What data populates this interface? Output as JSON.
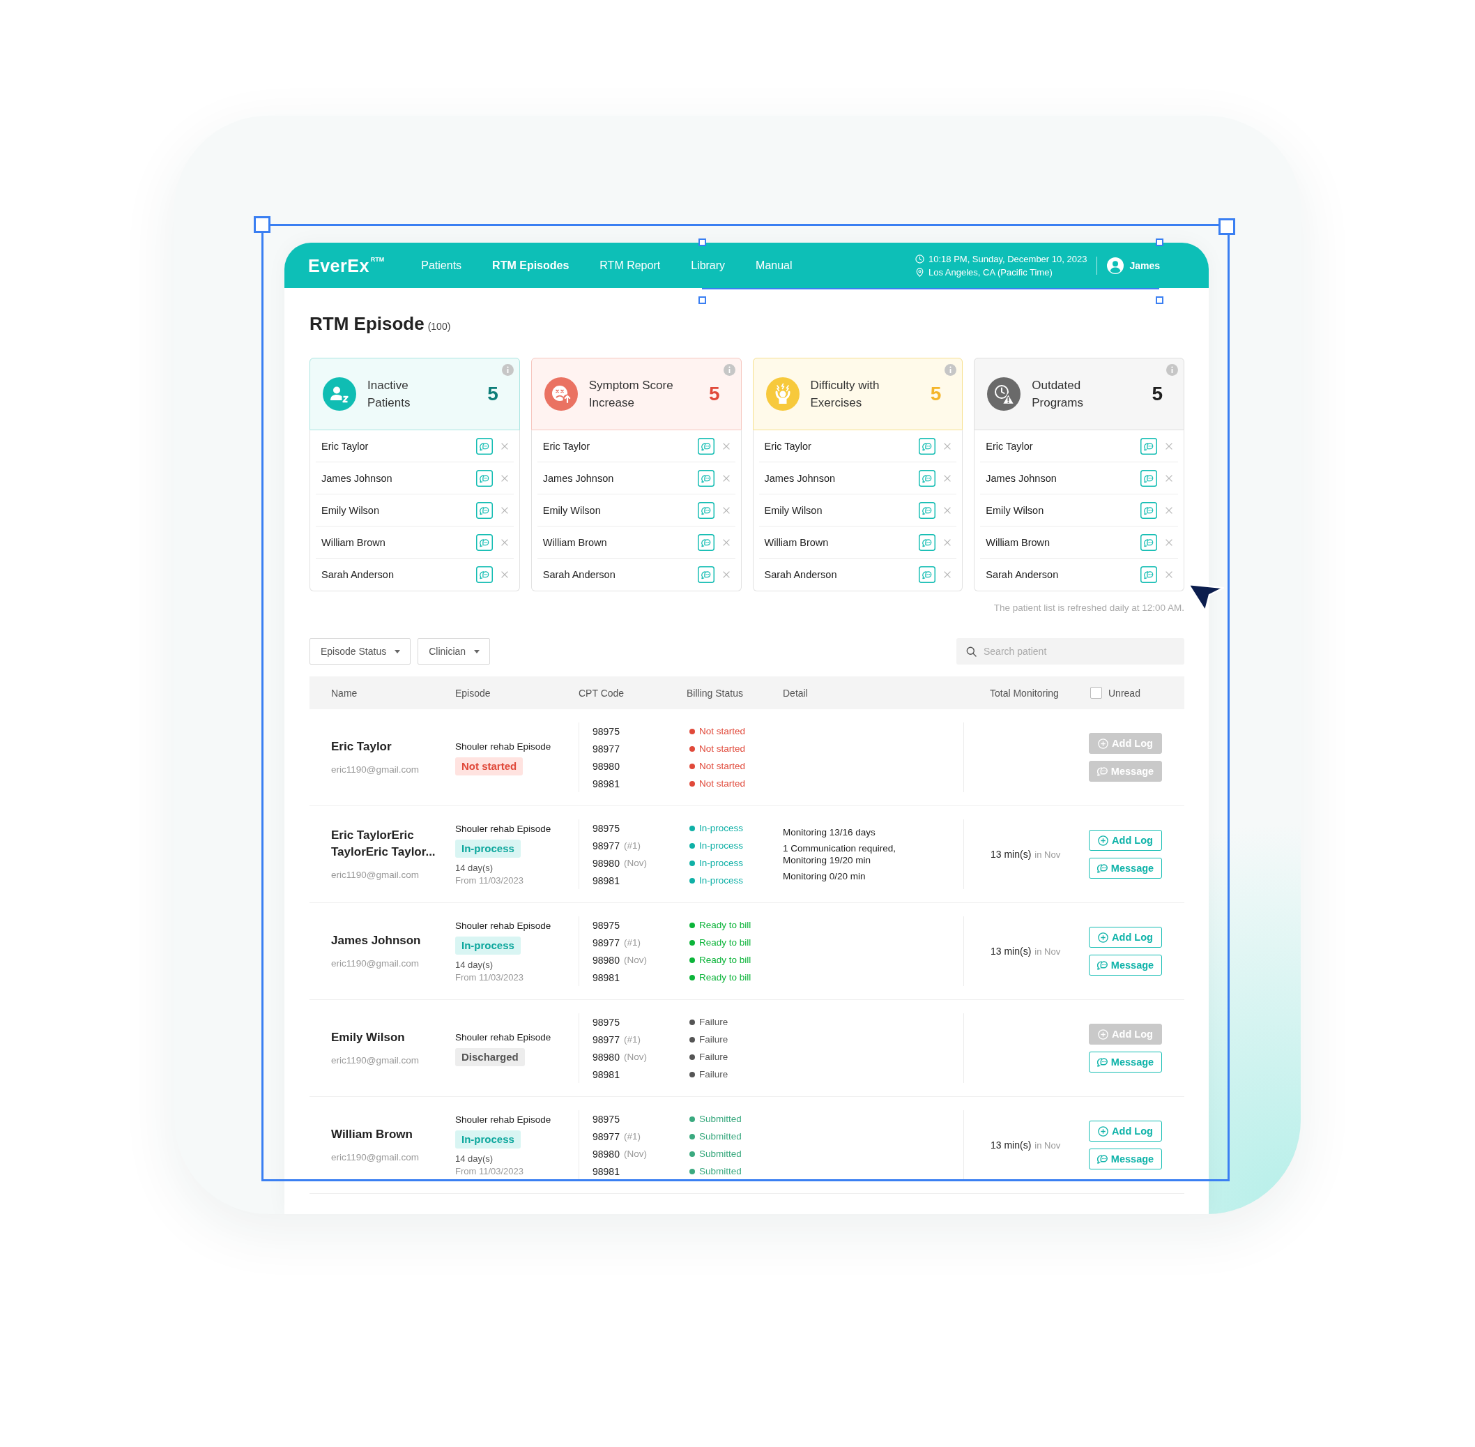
{
  "nav": {
    "logo": "EverEx",
    "logo_mark": "RTM",
    "items": [
      {
        "label": "Patients",
        "selected": false
      },
      {
        "label": "RTM Episodes",
        "selected": true
      },
      {
        "label": "RTM Report",
        "selected": false
      },
      {
        "label": "Library",
        "selected": false
      },
      {
        "label": "Manual",
        "selected": false
      }
    ],
    "datetime": "10:18 PM, Sunday, December 10, 2023",
    "location": "Los Angeles, CA (Pacific Time)",
    "user": "James"
  },
  "page_title": {
    "title": "RTM Episode",
    "count": "(100)"
  },
  "alert_cards": [
    {
      "kind": "inactive",
      "title": "Inactive\nPatients",
      "count": "5",
      "patients": [
        "Eric Taylor",
        "James Johnson",
        "Emily Wilson",
        "William Brown",
        "Sarah Anderson"
      ]
    },
    {
      "kind": "symptom",
      "title": "Symptom Score\nIncrease",
      "count": "5",
      "patients": [
        "Eric Taylor",
        "James Johnson",
        "Emily Wilson",
        "William Brown",
        "Sarah Anderson"
      ]
    },
    {
      "kind": "difficulty",
      "title": "Difficulty with\nExercises",
      "count": "5",
      "patients": [
        "Eric Taylor",
        "James Johnson",
        "Emily Wilson",
        "William Brown",
        "Sarah Anderson"
      ]
    },
    {
      "kind": "outdated",
      "title": "Outdated\nPrograms",
      "count": "5",
      "patients": [
        "Eric Taylor",
        "James Johnson",
        "Emily Wilson",
        "William Brown",
        "Sarah Anderson"
      ]
    }
  ],
  "refresh_note": "The patient list is refreshed daily at 12:00 AM.",
  "filters": [
    {
      "label": "Episode Status"
    },
    {
      "label": "Clinician"
    }
  ],
  "search": {
    "placeholder": "Search patient"
  },
  "table": {
    "columns": [
      "Name",
      "Episode",
      "CPT Code",
      "Billing Status",
      "Detail",
      "Total Monitoring"
    ],
    "unread": {
      "label": "Unread",
      "checked": false
    },
    "rows": [
      {
        "name": "Eric Taylor",
        "email": "eric1190@gmail.com",
        "episode": "Shouler rehab Episode",
        "status": {
          "kind": "not_started",
          "label": "Not started"
        },
        "codes": [
          {
            "code": "98975",
            "billing": "Not started",
            "kind": "not_started"
          },
          {
            "code": "98977",
            "billing": "Not started",
            "kind": "not_started"
          },
          {
            "code": "98980",
            "billing": "Not started",
            "kind": "not_started"
          },
          {
            "code": "98981",
            "billing": "Not started",
            "kind": "not_started"
          }
        ],
        "add_log": {
          "label": "Add Log",
          "disabled": true
        },
        "message": {
          "label": "Message",
          "disabled": true
        }
      },
      {
        "name": "Eric TaylorEric TaylorEric Taylor...",
        "email": "eric1190@gmail.com",
        "episode": "Shouler rehab Episode",
        "status": {
          "kind": "in_process",
          "label": "In-process"
        },
        "days": "14 day(s)",
        "from": "From 11/03/2023",
        "codes": [
          {
            "code": "98975",
            "billing": "In-process",
            "kind": "in_process"
          },
          {
            "code": "98977",
            "note": "(#1)",
            "billing": "In-process",
            "kind": "in_process"
          },
          {
            "code": "98980",
            "note": "(Nov)",
            "billing": "In-process",
            "kind": "in_process"
          },
          {
            "code": "98981",
            "billing": "In-process",
            "kind": "in_process"
          }
        ],
        "detail": [
          "Monitoring 13/16 days",
          "1 Communication required, Monitoring 19/20 min",
          "Monitoring 0/20 min"
        ],
        "monitoring": {
          "value": "13 min(s)",
          "period": "in Nov"
        },
        "add_log": {
          "label": "Add Log",
          "disabled": false
        },
        "message": {
          "label": "Message",
          "disabled": false
        }
      },
      {
        "name": "James Johnson",
        "email": "eric1190@gmail.com",
        "episode": "Shouler rehab Episode",
        "status": {
          "kind": "in_process",
          "label": "In-process"
        },
        "days": "14 day(s)",
        "from": "From 11/03/2023",
        "codes": [
          {
            "code": "98975",
            "billing": "Ready to bill",
            "kind": "ready"
          },
          {
            "code": "98977",
            "note": "(#1)",
            "billing": "Ready to bill",
            "kind": "ready"
          },
          {
            "code": "98980",
            "note": "(Nov)",
            "billing": "Ready to bill",
            "kind": "ready"
          },
          {
            "code": "98981",
            "billing": "Ready to bill",
            "kind": "ready"
          }
        ],
        "monitoring": {
          "value": "13 min(s)",
          "period": "in Nov"
        },
        "add_log": {
          "label": "Add Log",
          "disabled": false
        },
        "message": {
          "label": "Message",
          "disabled": false
        }
      },
      {
        "name": "Emily Wilson",
        "email": "eric1190@gmail.com",
        "episode": "Shouler rehab Episode",
        "status": {
          "kind": "discharged",
          "label": "Discharged"
        },
        "codes": [
          {
            "code": "98975",
            "billing": "Failure",
            "kind": "failure"
          },
          {
            "code": "98977",
            "note": "(#1)",
            "billing": "Failure",
            "kind": "failure"
          },
          {
            "code": "98980",
            "note": "(Nov)",
            "billing": "Failure",
            "kind": "failure"
          },
          {
            "code": "98981",
            "billing": "Failure",
            "kind": "failure"
          }
        ],
        "add_log": {
          "label": "Add Log",
          "disabled": true
        },
        "message": {
          "label": "Message",
          "disabled": false
        }
      },
      {
        "name": "William Brown",
        "email": "eric1190@gmail.com",
        "episode": "Shouler rehab Episode",
        "status": {
          "kind": "in_process",
          "label": "In-process"
        },
        "days": "14 day(s)",
        "from": "From 11/03/2023",
        "codes": [
          {
            "code": "98975",
            "billing": "Submitted",
            "kind": "submitted"
          },
          {
            "code": "98977",
            "note": "(#1)",
            "billing": "Submitted",
            "kind": "submitted"
          },
          {
            "code": "98980",
            "note": "(Nov)",
            "billing": "Submitted",
            "kind": "submitted"
          },
          {
            "code": "98981",
            "billing": "Submitted",
            "kind": "submitted"
          }
        ],
        "monitoring": {
          "value": "13 min(s)",
          "period": "in Nov"
        },
        "add_log": {
          "label": "Add Log",
          "disabled": false
        },
        "message": {
          "label": "Message",
          "disabled": false
        }
      }
    ]
  }
}
